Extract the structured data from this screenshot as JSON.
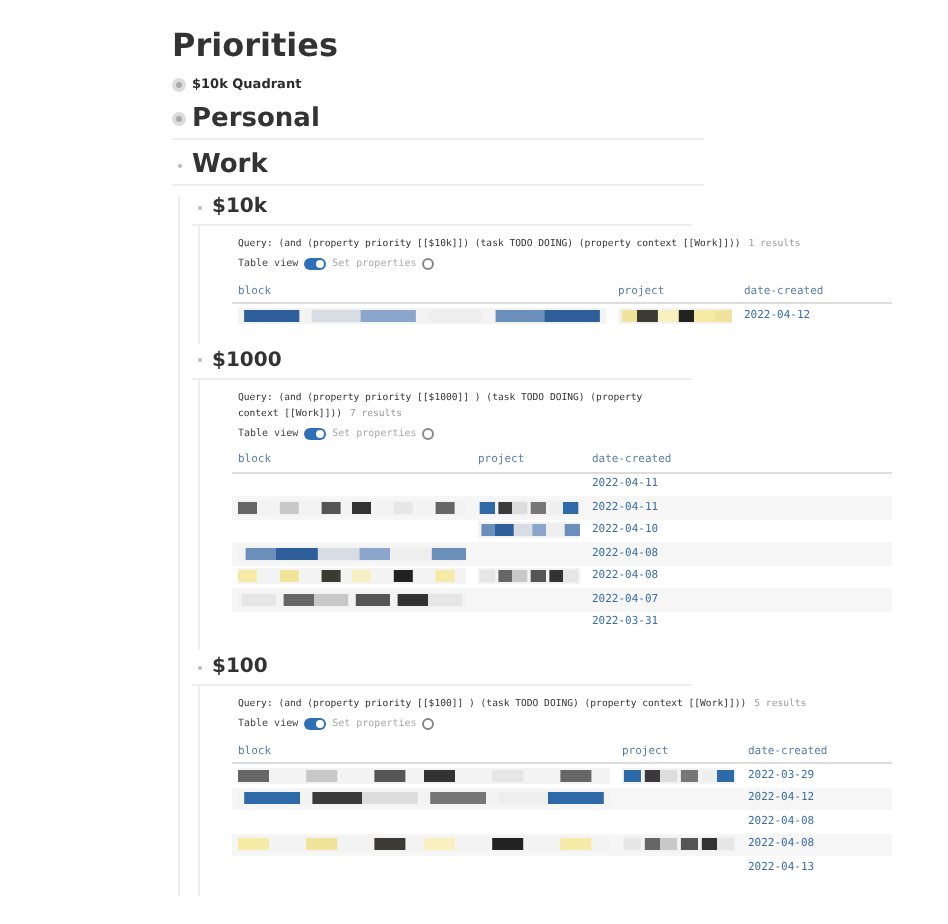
{
  "title": "Priorities",
  "blocks": [
    {
      "kind": "link",
      "text": "$10k Quadrant",
      "collapsed": true
    },
    {
      "kind": "heading",
      "text": "Personal",
      "collapsed": true
    },
    {
      "kind": "heading",
      "text": "Work",
      "collapsed": false,
      "children": [
        {
          "kind": "subheading",
          "text": "$10k",
          "collapsed": false,
          "children": [
            {
              "kind": "query",
              "query": "Query: (and (property priority [[$10k]]) (task TODO DOING) (property context [[Work]]))",
              "results": "1 results",
              "toggle_label": "Table view",
              "table_view": true,
              "settings_label": "Set properties",
              "columns": [
                "block",
                "project",
                "date-created"
              ],
              "rows": [
                {
                  "date": "2022-04-12"
                }
              ]
            }
          ]
        },
        {
          "kind": "subheading",
          "text": "$1000",
          "collapsed": false,
          "children": [
            {
              "kind": "query",
              "query": "Query: (and (property priority [[$1000]] ) (task TODO DOING) (property context [[Work]]))",
              "results": "7 results",
              "toggle_label": "Table view",
              "table_view": true,
              "settings_label": "Set properties",
              "columns": [
                "block",
                "project",
                "date-created"
              ],
              "rows": [
                {
                  "date": "2022-04-11"
                },
                {
                  "date": "2022-04-11"
                },
                {
                  "date": "2022-04-10"
                },
                {
                  "date": "2022-04-08"
                },
                {
                  "date": "2022-04-08"
                },
                {
                  "date": "2022-04-07"
                },
                {
                  "date": "2022-03-31"
                }
              ]
            }
          ]
        },
        {
          "kind": "subheading",
          "text": "$100",
          "collapsed": false,
          "children": [
            {
              "kind": "query",
              "query": "Query: (and (property priority [[$100]] ) (task TODO DOING) (property context [[Work]]))",
              "results": "5 results",
              "toggle_label": "Table view",
              "table_view": true,
              "settings_label": "Set properties",
              "columns": [
                "block",
                "project",
                "date-created"
              ],
              "rows": [
                {
                  "date": "2022-03-29"
                },
                {
                  "date": "2022-04-12"
                },
                {
                  "date": "2022-04-08"
                },
                {
                  "date": "2022-04-08"
                },
                {
                  "date": "2022-04-13"
                }
              ]
            }
          ]
        }
      ]
    }
  ]
}
